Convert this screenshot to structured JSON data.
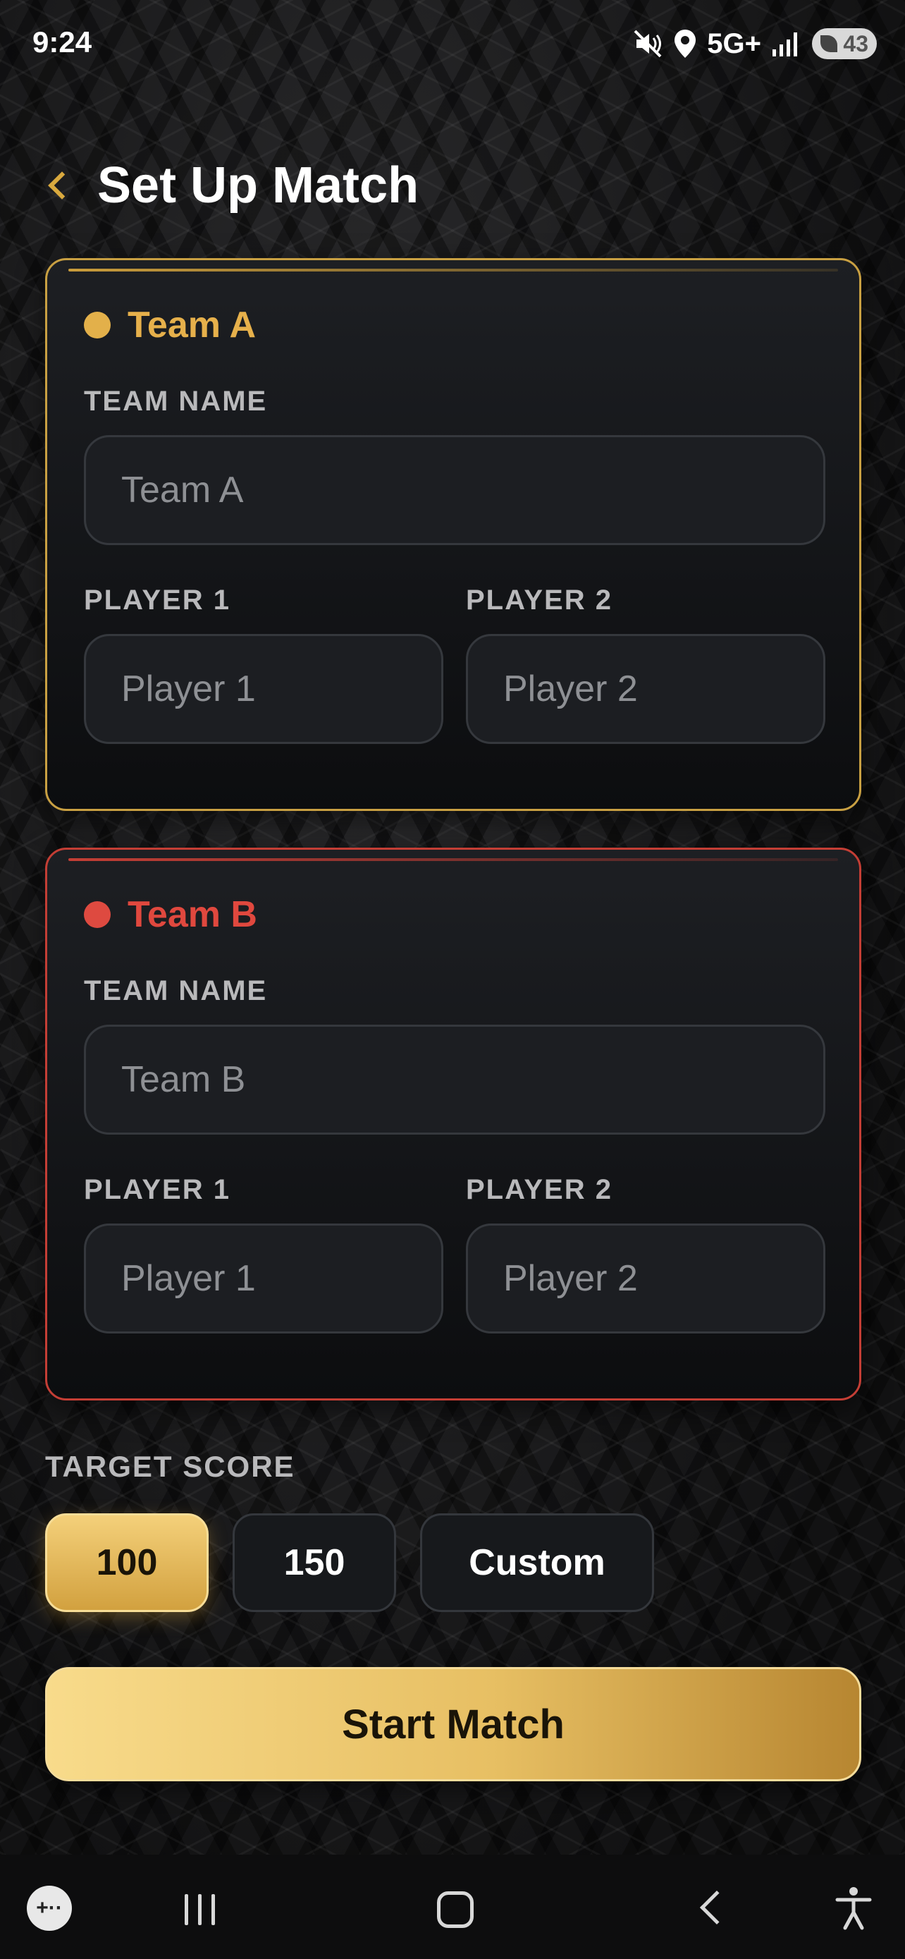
{
  "status_bar": {
    "time": "9:24",
    "network": "5G+",
    "battery": "43",
    "icons": [
      "mute-vibrate-icon",
      "location-icon",
      "signal-icon",
      "battery-icon"
    ]
  },
  "header": {
    "back_icon": "chevron-left-icon",
    "title": "Set Up Match"
  },
  "team_a": {
    "title": "Team A",
    "team_name_label": "TEAM NAME",
    "team_name_placeholder": "Team A",
    "player1_label": "PLAYER 1",
    "player1_placeholder": "Player 1",
    "player2_label": "PLAYER 2",
    "player2_placeholder": "Player 2",
    "color": "#e6b04b"
  },
  "team_b": {
    "title": "Team B",
    "team_name_label": "TEAM NAME",
    "team_name_placeholder": "Team B",
    "player1_label": "PLAYER 1",
    "player1_placeholder": "Player 1",
    "player2_label": "PLAYER 2",
    "player2_placeholder": "Player 2",
    "color": "#e0483e"
  },
  "target_score": {
    "label": "TARGET SCORE",
    "options": [
      "100",
      "150",
      "Custom"
    ],
    "selected": "100"
  },
  "start_button": "Start Match",
  "accent_colors": {
    "gold": "#e7bf63",
    "red": "#c43e35"
  },
  "nav_bar": {
    "icons": [
      "game-launcher-icon",
      "recent-apps-icon",
      "home-icon",
      "back-icon",
      "accessibility-icon"
    ]
  }
}
